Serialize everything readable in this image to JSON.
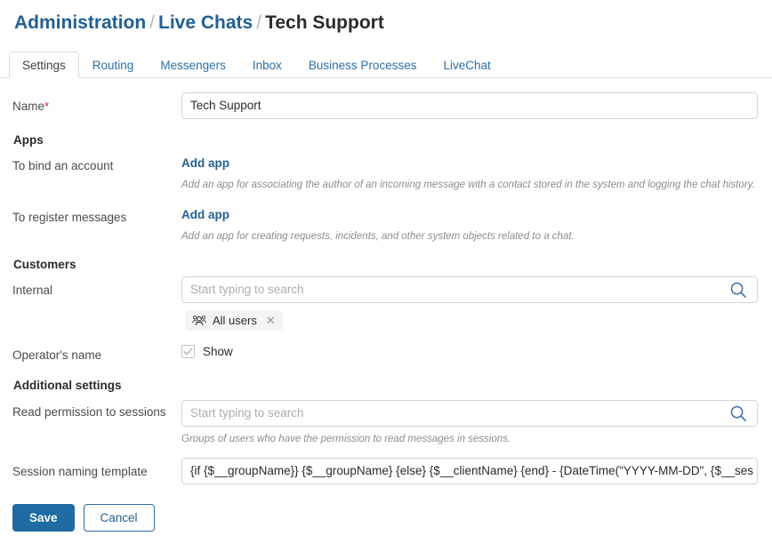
{
  "breadcrumb": {
    "items": [
      {
        "label": "Administration",
        "link": true
      },
      {
        "label": "Live Chats",
        "link": true
      },
      {
        "label": "Tech Support",
        "link": false
      }
    ],
    "separator": "/"
  },
  "tabs": [
    {
      "label": "Settings",
      "active": true
    },
    {
      "label": "Routing",
      "active": false
    },
    {
      "label": "Messengers",
      "active": false
    },
    {
      "label": "Inbox",
      "active": false
    },
    {
      "label": "Business Processes",
      "active": false
    },
    {
      "label": "LiveChat",
      "active": false
    }
  ],
  "form": {
    "name": {
      "label": "Name",
      "required_marker": "*",
      "value": "Tech Support"
    },
    "apps_section": "Apps",
    "bind_account": {
      "label": "To bind an account",
      "link": "Add app",
      "help": "Add an app for associating the author of an incoming message with a contact stored in the system and logging the chat history."
    },
    "register_messages": {
      "label": "To register messages",
      "link": "Add app",
      "help": "Add an app for creating requests, incidents, and other system objects related to a chat."
    },
    "customers_section": "Customers",
    "internal": {
      "label": "Internal",
      "placeholder": "Start typing to search",
      "value": "",
      "chips": [
        {
          "label": "All users",
          "icon": "users-group-icon",
          "close": "✕"
        }
      ]
    },
    "operator_name": {
      "label": "Operator's name",
      "checkbox_label": "Show",
      "checked": true
    },
    "additional_section": "Additional settings",
    "read_permission": {
      "label": "Read permission to sessions",
      "placeholder": "Start typing to search",
      "value": "",
      "help": "Groups of users who have the permission to read messages in sessions."
    },
    "session_template": {
      "label": "Session naming template",
      "value": "{if {$__groupName}} {$__groupName} {else} {$__clientName} {end} - {DateTime(\"YYYY-MM-DD\", {$__ses"
    }
  },
  "actions": {
    "save": "Save",
    "cancel": "Cancel"
  },
  "colors": {
    "link_blue": "#226092",
    "tab_blue": "#2f6ea5",
    "primary_button": "#1e6ca3",
    "required_red": "#e02020",
    "help_gray": "#8d8d8d"
  },
  "icons": {
    "search": "search-icon",
    "users_group": "users-group-icon",
    "check": "check-icon",
    "close": "close-icon"
  }
}
